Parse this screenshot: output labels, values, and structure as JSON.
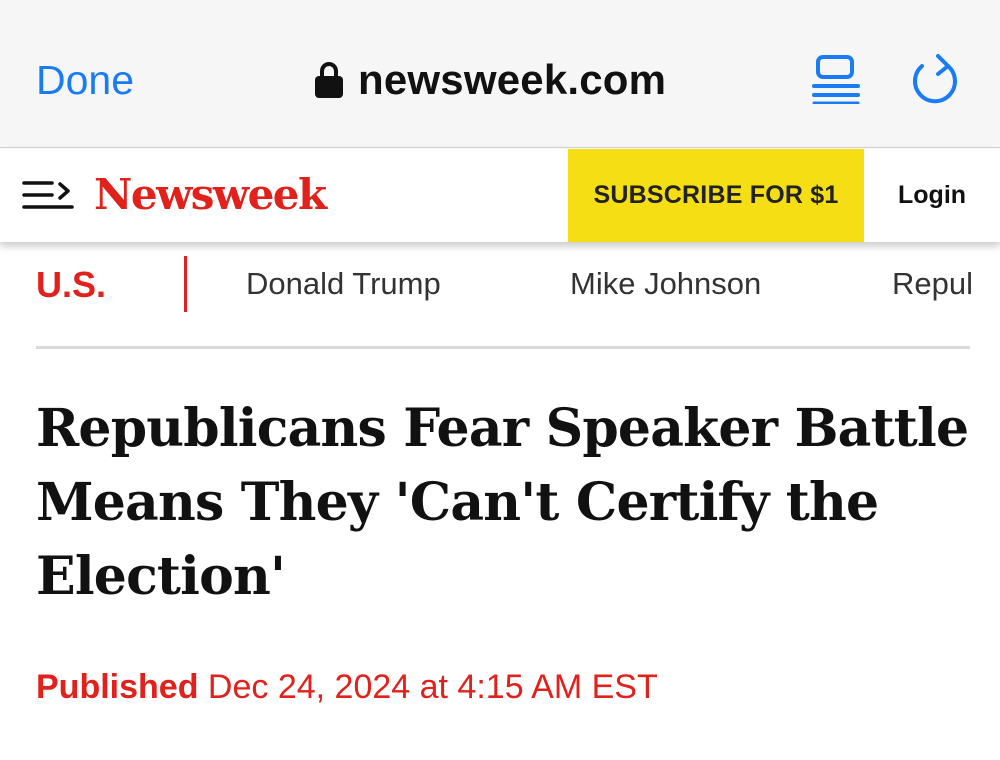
{
  "browser": {
    "done_label": "Done",
    "url": "newsweek.com",
    "icons": {
      "lock": "lock-icon",
      "reader": "reader-mode-icon",
      "reload": "reload-icon"
    },
    "accent_color": "#1a7cf5"
  },
  "header": {
    "menu_icon": "menu-icon",
    "logo_text": "Newsweek",
    "subscribe_label": "SUBSCRIBE FOR $1",
    "login_label": "Login",
    "brand_color": "#e0211c",
    "subscribe_color": "#f5de13"
  },
  "topic_nav": {
    "section": "U.S.",
    "items": [
      "Donald Trump",
      "Mike Johnson",
      "Repul"
    ]
  },
  "article": {
    "headline": "Republicans Fear Speaker Battle Means They 'Can't Certify the Election'",
    "published_label": "Published",
    "published_date": "Dec 24, 2024 at 4:15 AM EST"
  }
}
